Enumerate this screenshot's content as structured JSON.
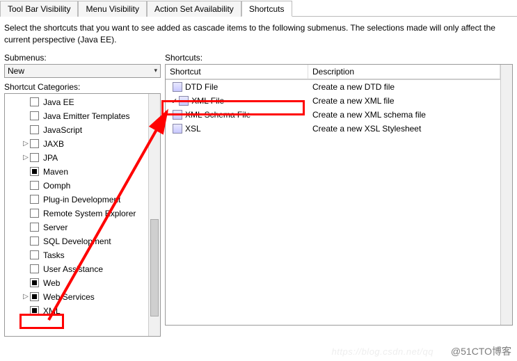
{
  "tabs": [
    {
      "label": "Tool Bar Visibility",
      "active": false
    },
    {
      "label": "Menu Visibility",
      "active": false
    },
    {
      "label": "Action Set Availability",
      "active": false
    },
    {
      "label": "Shortcuts",
      "active": true
    }
  ],
  "description": "Select the shortcuts that you want to see added as cascade items to the following submenus.  The selections made will only affect the current perspective (Java EE).",
  "submenusLabel": "Submenus:",
  "shortcutsLabel": "Shortcuts:",
  "submenuSelected": "New",
  "shortcutCategoriesLabel": "Shortcut Categories:",
  "categories": [
    {
      "label": "Java EE",
      "state": "empty",
      "twisty": ""
    },
    {
      "label": "Java Emitter Templates",
      "state": "empty",
      "twisty": ""
    },
    {
      "label": "JavaScript",
      "state": "empty",
      "twisty": ""
    },
    {
      "label": "JAXB",
      "state": "empty",
      "twisty": "▷"
    },
    {
      "label": "JPA",
      "state": "empty",
      "twisty": "▷"
    },
    {
      "label": "Maven",
      "state": "filled",
      "twisty": ""
    },
    {
      "label": "Oomph",
      "state": "empty",
      "twisty": ""
    },
    {
      "label": "Plug-in Development",
      "state": "empty",
      "twisty": ""
    },
    {
      "label": "Remote System Explorer",
      "state": "empty",
      "twisty": ""
    },
    {
      "label": "Server",
      "state": "empty",
      "twisty": ""
    },
    {
      "label": "SQL Development",
      "state": "empty",
      "twisty": ""
    },
    {
      "label": "Tasks",
      "state": "empty",
      "twisty": ""
    },
    {
      "label": "User Assistance",
      "state": "empty",
      "twisty": ""
    },
    {
      "label": "Web",
      "state": "filled",
      "twisty": ""
    },
    {
      "label": "Web Services",
      "state": "filled",
      "twisty": "▷"
    },
    {
      "label": "XML",
      "state": "filled",
      "twisty": ""
    }
  ],
  "tableHeaders": {
    "shortcut": "Shortcut",
    "description": "Description"
  },
  "shortcuts": [
    {
      "name": "DTD File",
      "desc": "Create a new DTD file",
      "checked": false
    },
    {
      "name": "XML File",
      "desc": "Create a new XML file",
      "checked": true
    },
    {
      "name": "XML Schema File",
      "desc": "Create a new XML schema file",
      "checked": false
    },
    {
      "name": "XSL",
      "desc": "Create a new XSL Stylesheet",
      "checked": false
    }
  ],
  "watermark": "@51CTO博客",
  "faintUrl": "https://blog.csdn.net/qq"
}
